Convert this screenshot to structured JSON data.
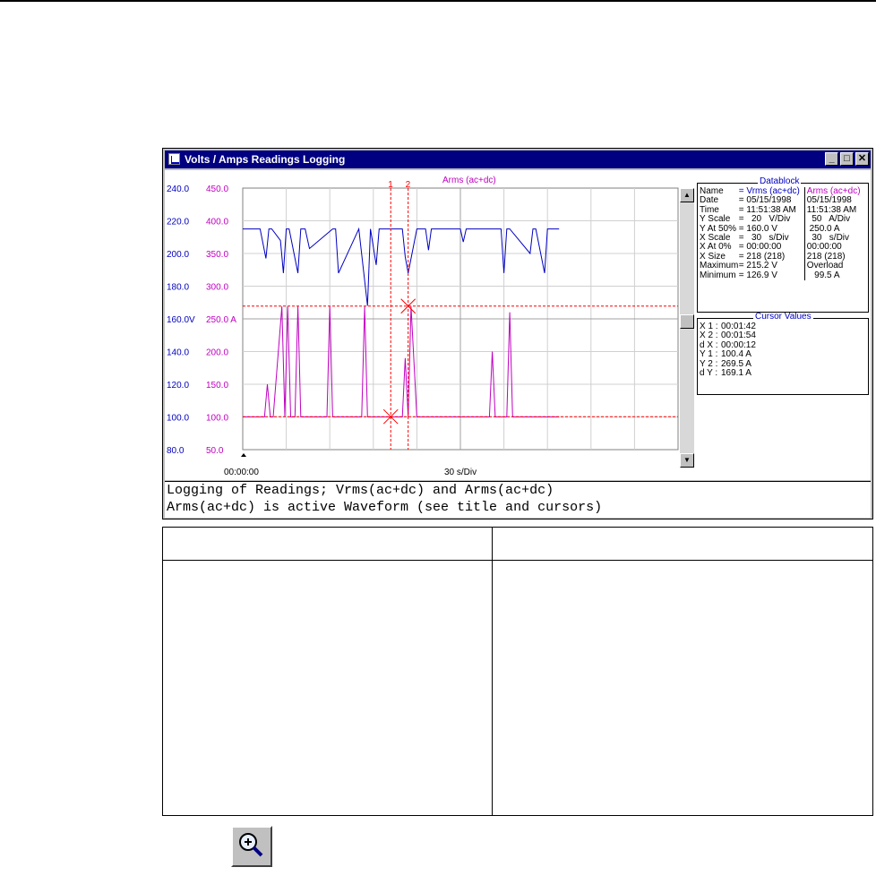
{
  "window": {
    "title": "Volts / Amps Readings Logging",
    "buttons": {
      "minimize": "_",
      "maximize": "□",
      "close": "✕"
    }
  },
  "chart_data": {
    "type": "line",
    "title": "Arms (ac+dc)",
    "x_label_start": "00:00:00",
    "x_label_scale": "30 s/Div",
    "x_divisions": 10,
    "y_divisions": 8,
    "left_axis_volts": {
      "ticks": [
        "240.0",
        "220.0",
        "200.0",
        "180.0",
        "160.0V",
        "140.0",
        "120.0",
        "100.0",
        "80.0"
      ],
      "color": "#0000c0"
    },
    "left_axis_amps": {
      "ticks": [
        "450.0",
        "400.0",
        "350.0",
        "300.0",
        "250.0 A",
        "200.0",
        "150.0",
        "100.0",
        "50.0"
      ],
      "color": "#c000c0"
    },
    "cursors": [
      {
        "label": "1",
        "x_seconds": 102,
        "y_amps": 100.4
      },
      {
        "label": "2",
        "x_seconds": 114,
        "y_amps": 269.5
      }
    ],
    "series": [
      {
        "name": "Vrms (ac+dc)",
        "color": "#0000c0",
        "x_seconds": [
          0,
          12,
          16,
          18,
          20,
          26,
          28,
          30,
          32,
          38,
          40,
          43,
          46,
          62,
          64,
          66,
          80,
          86,
          88,
          92,
          94,
          102,
          110,
          112,
          114,
          120,
          126,
          128,
          130,
          150,
          152,
          154,
          178,
          180,
          182,
          184,
          198,
          200,
          202,
          208,
          210,
          212,
          218
        ],
        "values_V": [
          215,
          215,
          197,
          215,
          215,
          208,
          188,
          215,
          215,
          188,
          215,
          215,
          203,
          215,
          215,
          188,
          215,
          168,
          215,
          193,
          215,
          215,
          215,
          198,
          188,
          215,
          215,
          202,
          215,
          215,
          207,
          215,
          215,
          188,
          215,
          215,
          200,
          215,
          215,
          188,
          215,
          215,
          215
        ]
      },
      {
        "name": "Arms (ac+dc)",
        "color": "#c000c0",
        "x_seconds": [
          0,
          15,
          17,
          19,
          21,
          27,
          29,
          31,
          33,
          36,
          38,
          40,
          43,
          45,
          47,
          58,
          60,
          62,
          64,
          66,
          80,
          82,
          84,
          86,
          88,
          92,
          94,
          96,
          102,
          110,
          112,
          114,
          116,
          120,
          126,
          128,
          130,
          170,
          172,
          174,
          176,
          178,
          182,
          184,
          186,
          188,
          218
        ],
        "values_A": [
          100,
          100,
          150,
          100,
          100,
          269,
          100,
          269,
          100,
          100,
          269,
          100,
          100,
          100,
          100,
          100,
          269,
          100,
          100,
          100,
          100,
          100,
          269,
          100,
          100,
          100,
          100,
          100,
          100,
          100,
          190,
          100,
          269,
          100,
          100,
          100,
          100,
          100,
          200,
          100,
          100,
          100,
          100,
          260,
          100,
          100,
          100
        ]
      }
    ]
  },
  "datablock": {
    "title": "Datablock",
    "header": {
      "col1": "Name",
      "col2": "= Vrms (ac+dc)",
      "col3": "Arms (ac+dc)"
    },
    "rows": [
      {
        "label": "Date",
        "v": "= 05/15/1998",
        "a": "05/15/1998"
      },
      {
        "label": "Time",
        "v": "= 11:51:38 AM",
        "a": "11:51:38 AM"
      },
      {
        "label": "Y Scale",
        "v": "=   20   V/Div",
        "a": "  50   A/Div"
      },
      {
        "label": "Y At 50%",
        "v": "= 160.0 V",
        "a": " 250.0 A"
      },
      {
        "label": "X Scale",
        "v": "=   30   s/Div",
        "a": "  30   s/Div"
      },
      {
        "label": "X At 0%",
        "v": "= 00:00:00",
        "a": "00:00:00"
      },
      {
        "label": "X Size",
        "v": "= 218 (218)",
        "a": "218 (218)"
      },
      {
        "label": "Maximum",
        "v": "= 215.2 V",
        "a": "Overload"
      },
      {
        "label": "Minimum",
        "v": "= 126.9 V",
        "a": "   99.5 A"
      }
    ]
  },
  "cursor_values": {
    "title": "Cursor Values",
    "rows": [
      {
        "label": "X 1 :",
        "value": "00:01:42"
      },
      {
        "label": "X 2 :",
        "value": "00:01:54"
      },
      {
        "label": "d X :",
        "value": "00:00:12"
      },
      {
        "label": "Y 1 :",
        "value": "100.4 A"
      },
      {
        "label": "Y 2 :",
        "value": "269.5 A"
      },
      {
        "label": "d Y :",
        "value": "169.1 A"
      }
    ]
  },
  "status": {
    "line1": "Logging of Readings; Vrms(ac+dc) and Arms(ac+dc)",
    "line2": "Arms(ac+dc) is active Waveform (see title and cursors)"
  },
  "toolbar": {
    "zoom_icon": "zoom-in-icon"
  }
}
